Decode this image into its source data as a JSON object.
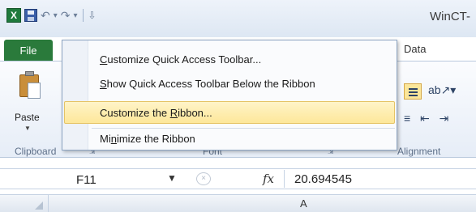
{
  "window": {
    "app_title": "WinCT-"
  },
  "quick_access_toolbar": {
    "app_icon_letter": "X",
    "undo_glyph": "↶",
    "dropdown_glyph": "▾",
    "redo_glyph": "↷",
    "customize_glyph": "⇩"
  },
  "tabs": {
    "file": "File",
    "data": "Data"
  },
  "ribbon": {
    "paste_label": "Paste",
    "groups": {
      "clipboard": "Clipboard",
      "font": "Font",
      "alignment": "Alignment"
    }
  },
  "context_menu": {
    "items": [
      {
        "pre": "",
        "key": "C",
        "post": "ustomize Quick Access Toolbar..."
      },
      {
        "pre": "",
        "key": "S",
        "post": "how Quick Access Toolbar Below the Ribbon"
      },
      {
        "pre": "Customize the ",
        "key": "R",
        "post": "ibbon..."
      },
      {
        "pre": "Mi",
        "key": "n",
        "post": "imize the Ribbon"
      }
    ],
    "highlighted_index": 2
  },
  "formula_bar": {
    "name_box": "F11",
    "fx_label": "fx",
    "value": "20.694545"
  },
  "grid": {
    "column_a": "A"
  },
  "colors": {
    "file_tab": "#2a7a3b",
    "highlight": "#fde79a"
  }
}
